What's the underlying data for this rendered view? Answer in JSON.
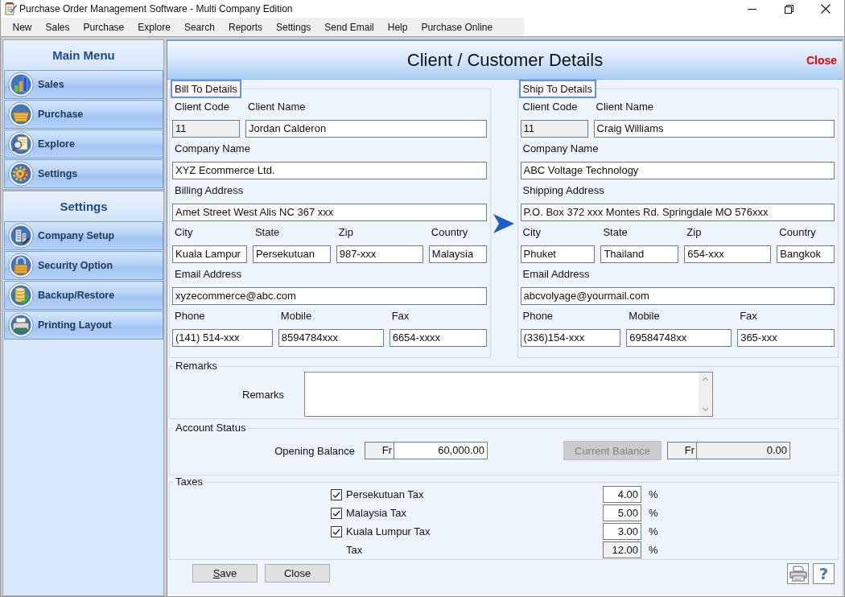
{
  "window": {
    "title": "Purchase Order Management Software - Multi Company Edition"
  },
  "menu_bar": [
    "New",
    "Sales",
    "Purchase",
    "Explore",
    "Search",
    "Reports",
    "Settings",
    "Send Email",
    "Help",
    "Purchase Online"
  ],
  "sidebar": {
    "sections": [
      {
        "title": "Main Menu",
        "items": [
          "Sales",
          "Purchase",
          "Explore",
          "Settings"
        ]
      },
      {
        "title": "Settings",
        "items": [
          "Company Setup",
          "Security Option",
          "Backup/Restore",
          "Printing Layout"
        ]
      }
    ]
  },
  "panel": {
    "title": "Client / Customer Details",
    "close_link": "Close"
  },
  "address_groups": [
    {
      "legend": "Bill To Details",
      "rows": [
        {
          "fields": [
            {
              "label": "Client Code",
              "value": "11",
              "read_only": true
            },
            {
              "label": "Client Name",
              "value": "Jordan Calderon",
              "read_only": false
            }
          ]
        },
        {
          "fields": [
            {
              "label": "Company Name",
              "value": "XYZ Ecommerce Ltd.",
              "read_only": false
            }
          ]
        },
        {
          "fields": [
            {
              "label": "Billing Address",
              "value": "Amet Street West Alis NC 367 xxx",
              "read_only": false
            }
          ]
        },
        {
          "fields": [
            {
              "label": "City",
              "value": "Kuala Lampur",
              "read_only": false
            },
            {
              "label": "State",
              "value": "Persekutuan",
              "read_only": false
            },
            {
              "label": "Zip",
              "value": "987-xxx",
              "read_only": false
            },
            {
              "label": "Country",
              "value": "Malaysia",
              "read_only": false
            }
          ]
        },
        {
          "fields": [
            {
              "label": "Email Address",
              "value": "xyzecommerce@abc.com",
              "read_only": false
            }
          ]
        },
        {
          "fields": [
            {
              "label": "Phone",
              "value": "(141) 514-xxx",
              "read_only": false
            },
            {
              "label": "Mobile",
              "value": "8594784xxx",
              "read_only": false
            },
            {
              "label": "Fax",
              "value": "6654-xxxx",
              "read_only": false
            }
          ]
        }
      ]
    },
    {
      "legend": "Ship To Details",
      "rows": [
        {
          "fields": [
            {
              "label": "Client Code",
              "value": "11",
              "read_only": true
            },
            {
              "label": "Client Name",
              "value": "Craig Williams",
              "read_only": false
            }
          ]
        },
        {
          "fields": [
            {
              "label": "Company Name",
              "value": "ABC Voltage Technology",
              "read_only": false
            }
          ]
        },
        {
          "fields": [
            {
              "label": "Shipping Address",
              "value": "P.O. Box 372 xxx Montes Rd. Springdale MO 576xxx",
              "read_only": false
            }
          ]
        },
        {
          "fields": [
            {
              "label": "City",
              "value": "Phuket",
              "read_only": false
            },
            {
              "label": "State",
              "value": "Thailand",
              "read_only": false
            },
            {
              "label": "Zip",
              "value": "654-xxx",
              "read_only": false
            },
            {
              "label": "Country",
              "value": "Bangkok",
              "read_only": false
            }
          ]
        },
        {
          "fields": [
            {
              "label": "Email Address",
              "value": "abcvolyage@yourmail.com",
              "read_only": false
            }
          ]
        },
        {
          "fields": [
            {
              "label": "Phone",
              "value": "(336)154-xxx",
              "read_only": false
            },
            {
              "label": "Mobile",
              "value": "69584748xx",
              "read_only": false
            },
            {
              "label": "Fax",
              "value": "365-xxx",
              "read_only": false
            }
          ]
        }
      ]
    }
  ],
  "remarks": {
    "legend": "Remarks",
    "label": "Remarks"
  },
  "account_status": {
    "legend": "Account Status",
    "opening_balance": {
      "label": "Opening Balance",
      "currency": "Fr",
      "value": "60,000.00",
      "read_only": false
    },
    "current_balance": {
      "label": "Current Balance",
      "disabled": true,
      "currency": "Fr",
      "value": "0.00",
      "read_only": true
    }
  },
  "taxes": {
    "legend": "Taxes",
    "items": [
      {
        "label": "Persekutuan Tax",
        "checked": true,
        "value": "4.00",
        "unit": "%"
      },
      {
        "label": "Malaysia Tax",
        "checked": true,
        "value": "5.00",
        "unit": "%"
      },
      {
        "label": "Kuala Lumpur Tax",
        "checked": true,
        "value": "3.00",
        "unit": "%"
      }
    ],
    "total": {
      "label": "Tax",
      "value": "12.00",
      "unit": "%",
      "read_only": true
    }
  },
  "footer": {
    "buttons": [
      {
        "label": "Save",
        "mnemonic": true
      },
      {
        "label": "Close",
        "mnemonic": false
      }
    ],
    "help_button": "?"
  }
}
